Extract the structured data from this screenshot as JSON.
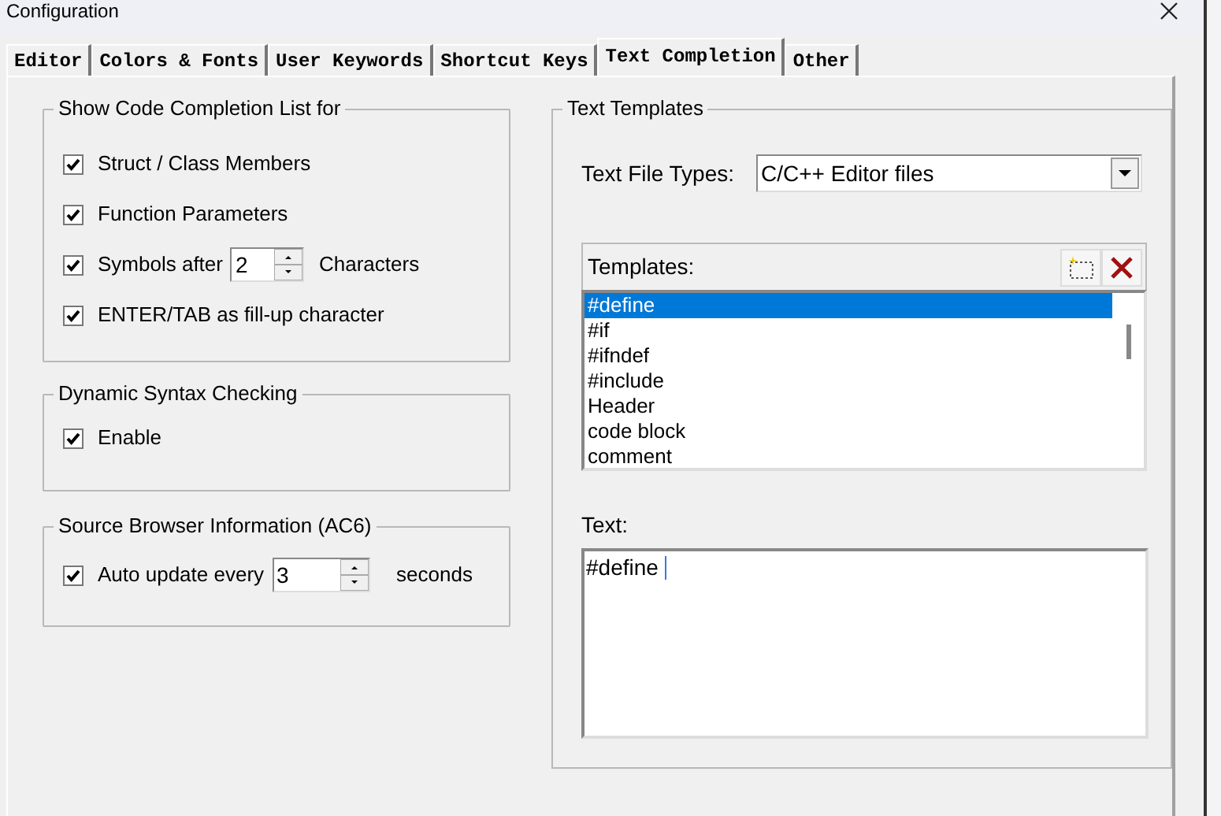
{
  "window": {
    "title": "Configuration"
  },
  "tabs": [
    {
      "label": "Editor",
      "selected": false
    },
    {
      "label": "Colors & Fonts",
      "selected": false
    },
    {
      "label": "User Keywords",
      "selected": false
    },
    {
      "label": "Shortcut Keys",
      "selected": false
    },
    {
      "label": "Text Completion",
      "selected": true
    },
    {
      "label": "Other",
      "selected": false
    }
  ],
  "code_completion": {
    "title": "Show Code Completion List for",
    "options": [
      {
        "kind": "checkbox",
        "label": "Struct / Class Members",
        "checked": true
      },
      {
        "kind": "checkbox",
        "label": "Function Parameters",
        "checked": true
      },
      {
        "kind": "spin",
        "label": "Symbols after",
        "value": "2",
        "suffix": "Characters",
        "checked": true
      },
      {
        "kind": "checkbox",
        "label": "ENTER/TAB as fill-up character",
        "checked": true
      }
    ]
  },
  "syntax_checking": {
    "title": "Dynamic Syntax Checking",
    "options": [
      {
        "kind": "checkbox",
        "label": "Enable",
        "checked": true
      }
    ]
  },
  "source_browser": {
    "title": "Source Browser Information (AC6)",
    "options": [
      {
        "kind": "spin",
        "label": "Auto update every",
        "value": "3",
        "suffix": "seconds",
        "checked": true
      }
    ]
  },
  "text_templates": {
    "title": "Text Templates",
    "file_types_label": "Text File Types:",
    "file_type": "C/C++ Editor files",
    "templates_label": "Templates:",
    "templates": [
      {
        "name": "#define",
        "selected": true
      },
      {
        "name": "#if",
        "selected": false
      },
      {
        "name": "#ifndef",
        "selected": false
      },
      {
        "name": "#include",
        "selected": false
      },
      {
        "name": "Header",
        "selected": false
      },
      {
        "name": "code block",
        "selected": false
      },
      {
        "name": "comment",
        "selected": false
      }
    ],
    "text_label": "Text:",
    "text": "#define "
  }
}
